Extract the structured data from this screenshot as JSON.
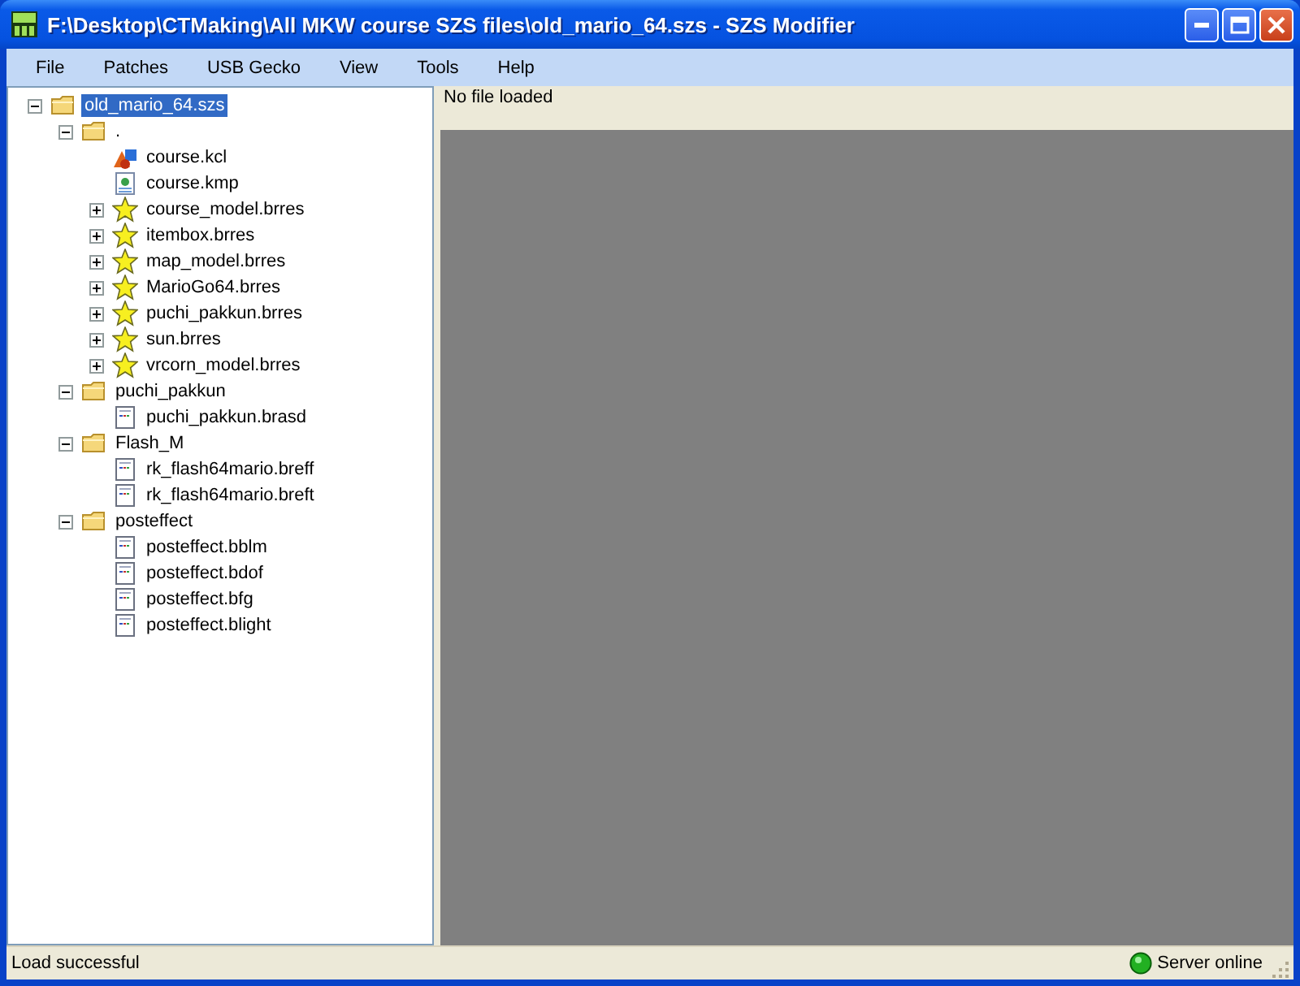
{
  "window": {
    "title": "F:\\Desktop\\CTMaking\\All MKW course SZS files\\old_mario_64.szs - SZS Modifier"
  },
  "menu": [
    "File",
    "Patches",
    "USB Gecko",
    "View",
    "Tools",
    "Help"
  ],
  "tree": [
    {
      "label": "old_mario_64.szs",
      "kind": "folder",
      "expanded": true,
      "selected": true,
      "children": [
        {
          "label": ".",
          "kind": "folder",
          "expanded": true,
          "selected": false,
          "children": [
            {
              "label": "course.kcl",
              "kind": "kcl",
              "selected": false
            },
            {
              "label": "course.kmp",
              "kind": "kmp",
              "selected": false
            },
            {
              "label": "course_model.brres",
              "kind": "brres",
              "expanded": false,
              "selected": false
            },
            {
              "label": "itembox.brres",
              "kind": "brres",
              "expanded": false,
              "selected": false
            },
            {
              "label": "map_model.brres",
              "kind": "brres",
              "expanded": false,
              "selected": false
            },
            {
              "label": "MarioGo64.brres",
              "kind": "brres",
              "expanded": false,
              "selected": false
            },
            {
              "label": "puchi_pakkun.brres",
              "kind": "brres",
              "expanded": false,
              "selected": false
            },
            {
              "label": "sun.brres",
              "kind": "brres",
              "expanded": false,
              "selected": false
            },
            {
              "label": "vrcorn_model.brres",
              "kind": "brres",
              "expanded": false,
              "selected": false
            }
          ]
        },
        {
          "label": "puchi_pakkun",
          "kind": "folder",
          "expanded": true,
          "selected": false,
          "children": [
            {
              "label": "puchi_pakkun.brasd",
              "kind": "file",
              "selected": false
            }
          ]
        },
        {
          "label": "Flash_M",
          "kind": "folder",
          "expanded": true,
          "selected": false,
          "children": [
            {
              "label": "rk_flash64mario.breff",
              "kind": "file",
              "selected": false
            },
            {
              "label": "rk_flash64mario.breft",
              "kind": "file",
              "selected": false
            }
          ]
        },
        {
          "label": "posteffect",
          "kind": "folder",
          "expanded": true,
          "selected": false,
          "children": [
            {
              "label": "posteffect.bblm",
              "kind": "file",
              "selected": false
            },
            {
              "label": "posteffect.bdof",
              "kind": "file",
              "selected": false
            },
            {
              "label": "posteffect.bfg",
              "kind": "file",
              "selected": false
            },
            {
              "label": "posteffect.blight",
              "kind": "file",
              "selected": false
            }
          ]
        }
      ]
    }
  ],
  "viewer": {
    "message": "No file loaded"
  },
  "status_bar": {
    "message": "Load successful",
    "server": "Server online"
  }
}
